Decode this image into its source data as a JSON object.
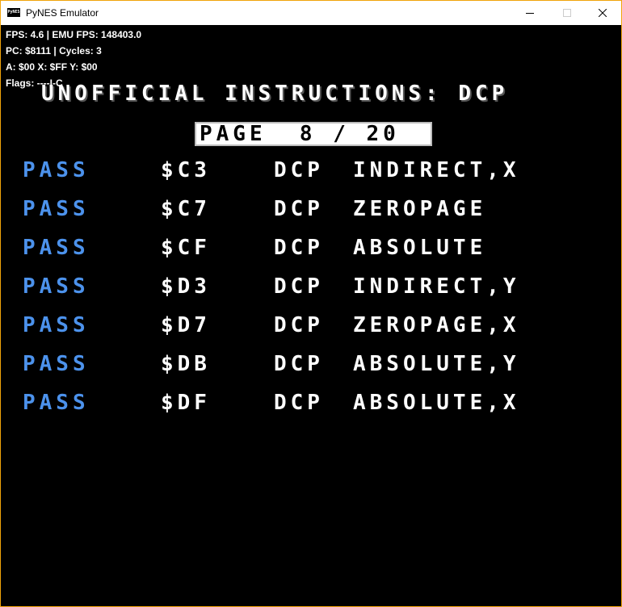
{
  "window": {
    "title": "PyNES Emulator",
    "icon": "pynes-app-icon",
    "icon_text": "PyNES",
    "controls": {
      "minimize": "minimize-icon",
      "maximize": "maximize-icon",
      "close": "close-icon"
    },
    "accent_color": "#f0a30a"
  },
  "hud": {
    "line1": "FPS: 4.6 | EMU FPS: 148403.0",
    "line2": "PC: $8111 | Cycles: 3",
    "line3": "A: $00 X: $FF Y: $00",
    "line4": "Flags: ----I-C"
  },
  "screen": {
    "heading": "UNOFFICIAL INSTRUCTIONS: DCP",
    "page_label": "PAGE  8 / 20",
    "status_color": "#4c92ec",
    "rows": [
      {
        "status": "PASS",
        "opcode": "$C3",
        "mnemonic": "DCP",
        "mode": "INDIRECT,X"
      },
      {
        "status": "PASS",
        "opcode": "$C7",
        "mnemonic": "DCP",
        "mode": "ZEROPAGE"
      },
      {
        "status": "PASS",
        "opcode": "$CF",
        "mnemonic": "DCP",
        "mode": "ABSOLUTE"
      },
      {
        "status": "PASS",
        "opcode": "$D3",
        "mnemonic": "DCP",
        "mode": "INDIRECT,Y"
      },
      {
        "status": "PASS",
        "opcode": "$D7",
        "mnemonic": "DCP",
        "mode": "ZEROPAGE,X"
      },
      {
        "status": "PASS",
        "opcode": "$DB",
        "mnemonic": "DCP",
        "mode": "ABSOLUTE,Y"
      },
      {
        "status": "PASS",
        "opcode": "$DF",
        "mnemonic": "DCP",
        "mode": "ABSOLUTE,X"
      }
    ]
  }
}
